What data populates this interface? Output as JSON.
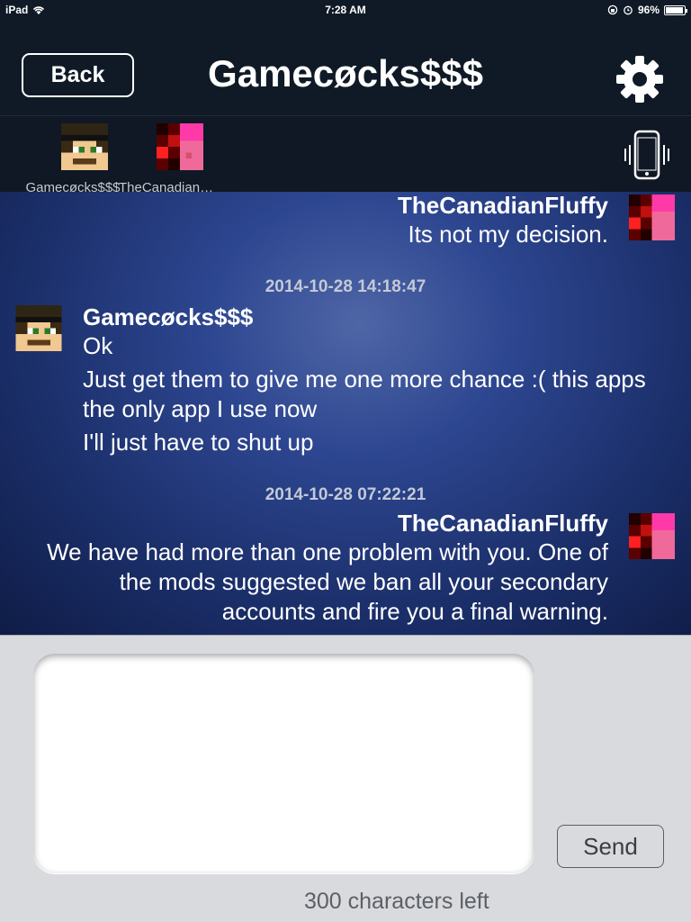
{
  "status_bar": {
    "device": "iPad",
    "time": "7:28 AM",
    "battery": "96%",
    "battery_level": 0.96
  },
  "nav": {
    "back_label": "Back",
    "title": "Gamecøcks$$$",
    "settings_icon": "gear-icon"
  },
  "participants": [
    {
      "label": "Gamecøcks$$$"
    },
    {
      "label": "TheCanadianFluffy"
    }
  ],
  "messages": [
    {
      "sender": "TheCanadianFluffy",
      "lines": [
        "Its not my decision."
      ]
    },
    {
      "timestamp": "2014-10-28 14:18:47"
    },
    {
      "sender": "Gamecøcks$$$",
      "lines": [
        "Ok",
        "Just get them to give me one more chance :( this apps the only app I use now",
        "I'll just have to shut up"
      ]
    },
    {
      "timestamp": "2014-10-28 07:22:21"
    },
    {
      "sender": "TheCanadianFluffy",
      "lines": [
        "We have had more than one problem with you. One of the mods suggested we ban all your secondary accounts and fire you a final warning."
      ]
    }
  ],
  "composer": {
    "input_value": "",
    "send_label": "Send",
    "chars_left": "300 characters left"
  },
  "colors": {
    "nav_background": "#101a27",
    "chat_background": "#2d4690"
  }
}
